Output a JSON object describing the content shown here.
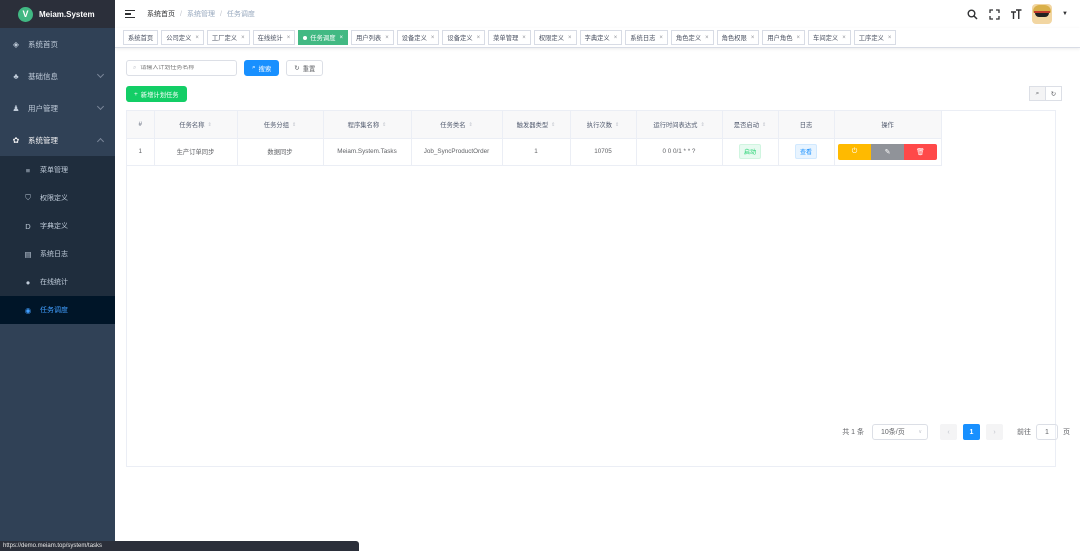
{
  "app": {
    "logo_letter": "V",
    "title": "Meiam.System"
  },
  "sidebar": {
    "items": [
      {
        "label": "系统首页",
        "icon": "dashboard-icon"
      },
      {
        "label": "基础信息",
        "icon": "tree-icon",
        "has_arrow": true
      },
      {
        "label": "用户管理",
        "icon": "user-icon",
        "has_arrow": true
      },
      {
        "label": "系统管理",
        "icon": "gear-icon",
        "has_arrow": true,
        "expanded": true
      }
    ],
    "submenu": [
      {
        "label": "菜单管理",
        "icon": "list-icon"
      },
      {
        "label": "权限定义",
        "icon": "shield-icon"
      },
      {
        "label": "字典定义",
        "icon": "dictionary-icon"
      },
      {
        "label": "系统日志",
        "icon": "log-icon"
      },
      {
        "label": "在线统计",
        "icon": "globe-icon"
      },
      {
        "label": "任务调度",
        "icon": "clock-icon",
        "active": true
      }
    ]
  },
  "breadcrumb": [
    "系统首页",
    "系统管理",
    "任务调度"
  ],
  "tags": [
    {
      "label": "系统首页",
      "closable": false
    },
    {
      "label": "公司定义",
      "closable": true
    },
    {
      "label": "工厂定义",
      "closable": true
    },
    {
      "label": "在线统计",
      "closable": true
    },
    {
      "label": "任务调度",
      "closable": true,
      "active": true
    },
    {
      "label": "用户列表",
      "closable": true
    },
    {
      "label": "设备定义",
      "closable": true
    },
    {
      "label": "设备定义",
      "closable": true
    },
    {
      "label": "菜单管理",
      "closable": true
    },
    {
      "label": "权限定义",
      "closable": true
    },
    {
      "label": "字典定义",
      "closable": true
    },
    {
      "label": "系统日志",
      "closable": true
    },
    {
      "label": "角色定义",
      "closable": true
    },
    {
      "label": "角色权限",
      "closable": true
    },
    {
      "label": "用户角色",
      "closable": true
    },
    {
      "label": "车间定义",
      "closable": true
    },
    {
      "label": "工序定义",
      "closable": true
    }
  ],
  "search": {
    "placeholder": "请输入计划任务名称",
    "value": "",
    "search_label": "搜索",
    "reset_label": "重置"
  },
  "toolbar": {
    "add_label": "新增计划任务"
  },
  "table": {
    "columns": [
      {
        "label": "#",
        "sortable": false
      },
      {
        "label": "任务名称",
        "sortable": true
      },
      {
        "label": "任务分组",
        "sortable": true
      },
      {
        "label": "程序集名称",
        "sortable": true
      },
      {
        "label": "任务类名",
        "sortable": true
      },
      {
        "label": "触发器类型",
        "sortable": true
      },
      {
        "label": "执行次数",
        "sortable": true
      },
      {
        "label": "运行时间表达式",
        "sortable": true
      },
      {
        "label": "是否启动",
        "sortable": true
      },
      {
        "label": "日志",
        "sortable": false
      },
      {
        "label": "操作",
        "sortable": false
      }
    ],
    "rows": [
      {
        "index": "1",
        "name": "生产订单同步",
        "group": "数据同步",
        "assembly": "Meiam.System.Tasks",
        "class": "Job_SyncProductOrder",
        "trigger_type": "1",
        "run_count": "10705",
        "cron": "0 0 0/1 * * ?",
        "status": "启动",
        "log_label": "查看"
      }
    ]
  },
  "pagination": {
    "total_text": "共 1 条",
    "page_size": "10条/页",
    "current_page": "1",
    "goto_label": "前往",
    "goto_value": "1",
    "page_unit": "页"
  },
  "statusbar": {
    "url": "https://demo.meiam.top/system/tasks"
  },
  "colors": {
    "sidebar_bg": "#304156",
    "active_tag": "#42b983",
    "primary": "#1890ff",
    "success": "#13ce66",
    "warning": "#ffba00",
    "danger": "#ff4949"
  }
}
